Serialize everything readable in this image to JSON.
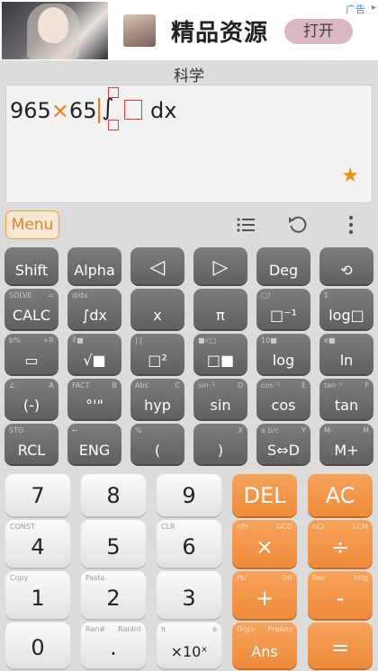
{
  "ad": {
    "title": "精品资源",
    "open_label": "打开",
    "tag": "广告"
  },
  "mode_label": "科学",
  "display": {
    "expr_left": "965",
    "expr_op": "×",
    "expr_right": "65",
    "int_sign": "∫",
    "dx": "dx"
  },
  "toolbar": {
    "menu_label": "Menu",
    "history_icon": "list-icon",
    "undo_icon": "undo-icon",
    "more_icon": "more-vertical-icon"
  },
  "keys": {
    "r1": [
      {
        "main": "Shift",
        "sub_l": "",
        "sub_r": ""
      },
      {
        "main": "Alpha",
        "sub_l": "",
        "sub_r": ""
      },
      {
        "main": "◁",
        "sub_l": "",
        "sub_r": ""
      },
      {
        "main": "▷",
        "sub_l": "",
        "sub_r": ""
      },
      {
        "main": "Deg",
        "sub_l": "",
        "sub_r": ""
      },
      {
        "main": "⟲",
        "sub_l": "",
        "sub_r": ""
      }
    ],
    "r2": [
      {
        "main": "CALC",
        "sub_l": "SOLVE",
        "sub_r": "="
      },
      {
        "main": "∫dx",
        "sub_l": "d/dx",
        "sub_r": ""
      },
      {
        "main": "x",
        "sub_l": "",
        "sub_r": ""
      },
      {
        "main": "π",
        "sub_l": "",
        "sub_r": ""
      },
      {
        "main": "□⁻¹",
        "sub_l": "□!",
        "sub_r": ""
      },
      {
        "main": "log□",
        "sub_l": "Σ",
        "sub_r": ""
      }
    ],
    "r3": [
      {
        "main": "▭",
        "sub_l": "b%",
        "sub_r": "÷R"
      },
      {
        "main": "√■",
        "sub_l": "∛■",
        "sub_r": ""
      },
      {
        "main": "□²",
        "sub_l": "| |",
        "sub_r": ""
      },
      {
        "main": "□■",
        "sub_l": "■√□",
        "sub_r": ""
      },
      {
        "main": "log",
        "sub_l": "10■",
        "sub_r": ""
      },
      {
        "main": "ln",
        "sub_l": "e■",
        "sub_r": ""
      }
    ],
    "r4": [
      {
        "main": "(-)",
        "sub_l": "∠",
        "sub_r": "A"
      },
      {
        "main": "°'\"",
        "sub_l": "FACT",
        "sub_r": "B"
      },
      {
        "main": "hyp",
        "sub_l": "Abs",
        "sub_r": "C"
      },
      {
        "main": "sin",
        "sub_l": "sin⁻¹",
        "sub_r": "D"
      },
      {
        "main": "cos",
        "sub_l": "cos⁻¹",
        "sub_r": "E"
      },
      {
        "main": "tan",
        "sub_l": "tan⁻¹",
        "sub_r": "F"
      }
    ],
    "r5": [
      {
        "main": "RCL",
        "sub_l": "STO",
        "sub_r": ""
      },
      {
        "main": "ENG",
        "sub_l": "←",
        "sub_r": ""
      },
      {
        "main": "(",
        "sub_l": "%",
        "sub_r": ""
      },
      {
        "main": ")",
        "sub_l": "",
        "sub_r": "X"
      },
      {
        "main": "S⇔D",
        "sub_l": "a b/c",
        "sub_r": "Y"
      },
      {
        "main": "M+",
        "sub_l": "M-",
        "sub_r": "M"
      }
    ],
    "n1": [
      {
        "main": "7",
        "sub_l": "",
        "sub_r": ""
      },
      {
        "main": "8",
        "sub_l": "",
        "sub_r": ""
      },
      {
        "main": "9",
        "sub_l": "",
        "sub_r": ""
      },
      {
        "main": "DEL",
        "sub_l": "",
        "sub_r": ""
      },
      {
        "main": "AC",
        "sub_l": "",
        "sub_r": ""
      }
    ],
    "n2": [
      {
        "main": "4",
        "sub_l": "CONST",
        "sub_r": ""
      },
      {
        "main": "5",
        "sub_l": "",
        "sub_r": ""
      },
      {
        "main": "6",
        "sub_l": "CLR",
        "sub_r": ""
      },
      {
        "main": "×",
        "sub_l": "nPr",
        "sub_r": "GCD"
      },
      {
        "main": "÷",
        "sub_l": "nCr",
        "sub_r": "LCM"
      }
    ],
    "n3": [
      {
        "main": "1",
        "sub_l": "Copy",
        "sub_r": ""
      },
      {
        "main": "2",
        "sub_l": "Paste",
        "sub_r": ""
      },
      {
        "main": "3",
        "sub_l": "",
        "sub_r": ""
      },
      {
        "main": "+",
        "sub_l": "Pol",
        "sub_r": "Int"
      },
      {
        "main": "-",
        "sub_l": "Rec",
        "sub_r": "Intg"
      }
    ],
    "n4": [
      {
        "main": "0",
        "sub_l": "",
        "sub_r": ""
      },
      {
        "main": ".",
        "sub_l": "Ran#",
        "sub_r": "RanInt"
      },
      {
        "main": "×10ˣ",
        "sub_l": "π",
        "sub_r": "e"
      },
      {
        "main": "Ans",
        "sub_l": "Drg>",
        "sub_r": "PreAns"
      },
      {
        "main": "=",
        "sub_l": "",
        "sub_r": ""
      }
    ]
  },
  "colors": {
    "accent": "#f0a03c",
    "cursor": "#f07a15",
    "placeholder_box": "#e53935",
    "star": "#e8940e"
  }
}
